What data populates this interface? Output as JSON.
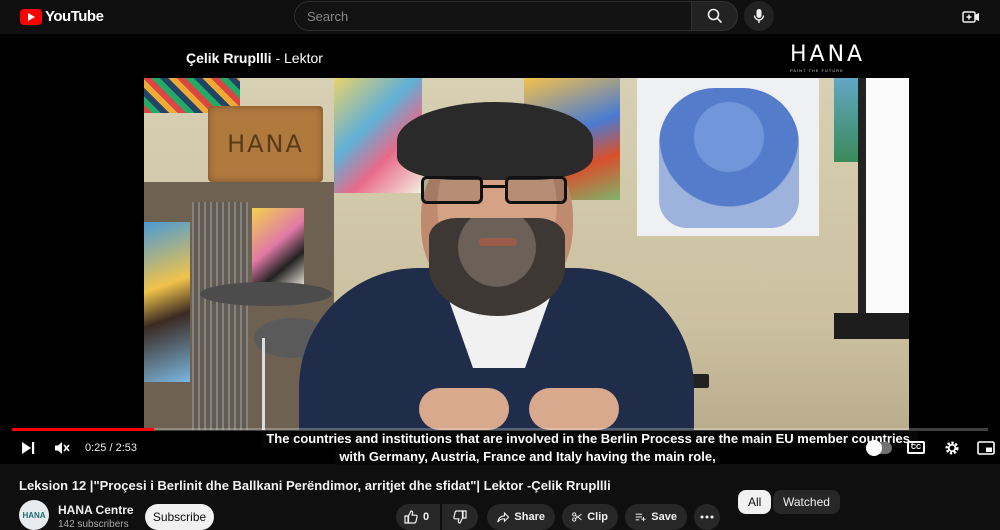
{
  "topbar": {
    "logo_text": "YouTube",
    "search_placeholder": "Search"
  },
  "video": {
    "header_name": "Çelik Rrupllli",
    "header_role": "- Lektor",
    "hana_mark": "HANA",
    "hana_sub": "PAINT THE FUTURE",
    "sign_text": "HANA",
    "caption_line_1": "The countries and institutions that are involved in the Berlin Process are the main EU member countries,",
    "caption_line_2": "with Germany, Austria, France and Italy having the main role,",
    "progress": 0.145
  },
  "controls": {
    "time_current": "0:25",
    "time_separator": "/",
    "time_total": "2:53",
    "cc_label": "CC"
  },
  "info": {
    "title": "Leksion 12 |\"Proçesi i Berlinit dhe Ballkani Perëndimor, arritjet dhe sfidat\"| Lektor -Çelik Rrupllli",
    "channel_name": "HANA Centre",
    "subscribers": "142 subscribers",
    "subscribe_label": "Subscribe",
    "avatar_text": "HANA",
    "likes": "0",
    "share_label": "Share",
    "clip_label": "Clip",
    "save_label": "Save"
  },
  "chips": {
    "all": "All",
    "watched": "Watched"
  },
  "colors": {
    "accent": "#ff0000",
    "background": "#0f0f0f"
  }
}
